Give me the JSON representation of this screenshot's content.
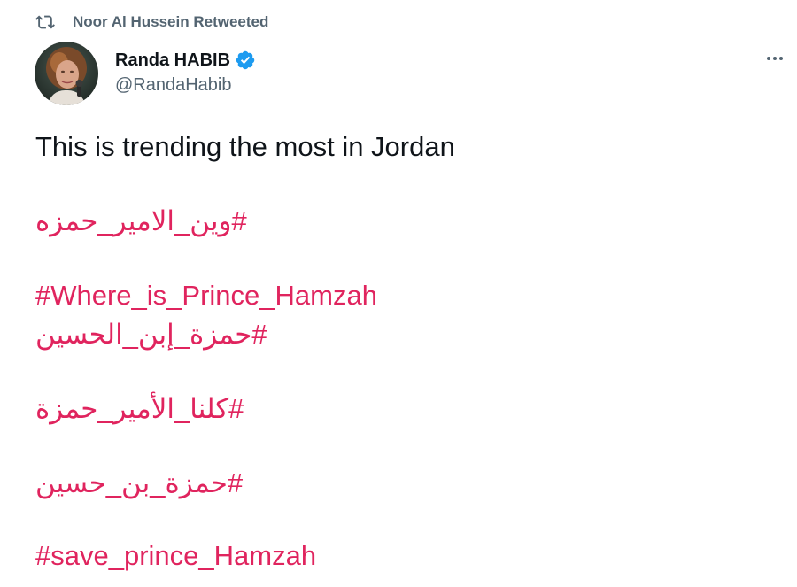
{
  "retweet": {
    "icon": "retweet-icon",
    "text": "Noor Al Hussein Retweeted"
  },
  "author": {
    "avatar": "avatar",
    "name": "Randa HABIB",
    "verified_icon": "verified-badge-icon",
    "handle": "@RandaHabib"
  },
  "more_icon": "more-options-icon",
  "tweet": {
    "text": "This is trending the most in Jordan",
    "hashtags": [
      "#وين_الامير_حمزه",
      "#Where_is_Prince_Hamzah",
      "#حمزة_إبن_الحسين",
      "#كلنا_الأمير_حمزة",
      "#حمزة_بن_حسين",
      "#save_prince_Hamzah"
    ]
  },
  "colors": {
    "text": "#0f1419",
    "secondary": "#536471",
    "hashtag": "#e0245e",
    "verified": "#1d9bf0"
  }
}
